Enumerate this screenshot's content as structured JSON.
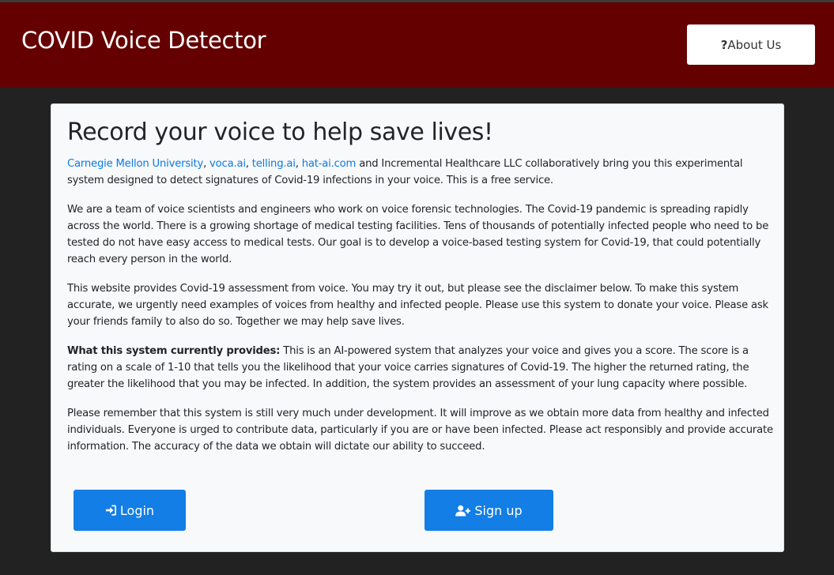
{
  "header": {
    "title": "COVID Voice Detector",
    "about_icon": "?",
    "about_label": "About Us"
  },
  "card": {
    "title": "Record your voice to help save lives!",
    "intro": {
      "links": [
        "Carnegie Mellon University",
        "voca.ai",
        "telling.ai",
        "hat-ai.com"
      ],
      "sep1": ", ",
      "sep2": ", ",
      "sep3": ", ",
      "text": " and Incremental Healthcare LLC collaboratively bring you this experimental system designed to detect signatures of Covid-19 infections in your voice. This is a free service."
    },
    "para2": "We are a team of voice scientists and engineers who work on voice forensic technologies. The Covid-19 pandemic is spreading rapidly across the world. There is a growing shortage of medical testing facilities. Tens of thousands of potentially infected people who need to be tested do not have easy access to medical tests. Our goal is to develop a voice-based testing system for Covid-19, that could potentially reach every person in the world.",
    "para3": "This website provides Covid-19 assessment from voice. You may try it out, but please see the disclaimer below. To make this system accurate, we urgently need examples of voices from healthy and infected people. Please use this system to donate your voice. Please ask your friends family to also do so. Together we may help save lives.",
    "para4_bold": "What this system currently provides:",
    "para4_text": " This is an AI-powered system that analyzes your voice and gives you a score. The score is a rating on a scale of 1-10 that tells you the likelihood that your voice carries signatures of Covid-19. The higher the returned rating, the greater the likelihood that you may be infected. In addition, the system provides an assessment of your lung capacity where possible.",
    "para5": "Please remember that this system is still very much under development. It will improve as we obtain more data from healthy and infected individuals. Everyone is urged to contribute data, particularly if you are or have been infected. Please act responsibly and provide accurate information. The accuracy of the data we obtain will dictate our ability to succeed."
  },
  "buttons": {
    "login_label": "Login",
    "login_icon": "sign-in-icon",
    "signup_label": "Sign up",
    "signup_icon": "user-plus-icon"
  },
  "colors": {
    "header_bg": "#640000",
    "page_bg": "#222222",
    "link": "#0a7be3",
    "primary_button": "#127ee6"
  }
}
